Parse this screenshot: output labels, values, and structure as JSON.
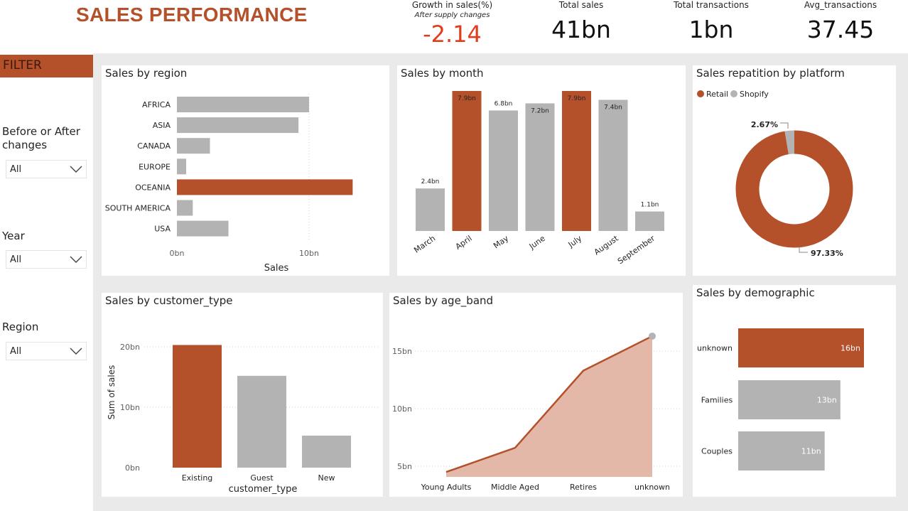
{
  "header": {
    "title": "SALES PERFORMANCE"
  },
  "kpis": {
    "growth": {
      "label": "Growth in sales(%)",
      "sublabel": "After supply changes",
      "value": "-2.14",
      "color": "#e03c1d"
    },
    "total_sales": {
      "label": "Total sales",
      "value": "41bn"
    },
    "total_transactions": {
      "label": "Total transactions",
      "value": "1bn"
    },
    "avg_transactions": {
      "label": "Avg_transactions",
      "value": "37.45"
    }
  },
  "filters": {
    "header": "FILTER",
    "items": [
      {
        "label": "Before or After changes",
        "value": "All"
      },
      {
        "label": "Year",
        "value": "All"
      },
      {
        "label": "Region",
        "value": "All"
      }
    ]
  },
  "colors": {
    "accent": "#b4502a",
    "neutral": "#b3b3b3",
    "area_fill": "#e3b8a8"
  },
  "chart_data": [
    {
      "id": "region",
      "type": "bar",
      "orientation": "horizontal",
      "title": "Sales by region",
      "xlabel": "Sales",
      "categories": [
        "AFRICA",
        "ASIA",
        "CANADA",
        "EUROPE",
        "OCEANIA",
        "SOUTH AMERICA",
        "USA"
      ],
      "values": [
        10.0,
        9.2,
        2.5,
        0.7,
        13.3,
        1.2,
        3.9
      ],
      "highlight": [
        false,
        false,
        false,
        false,
        true,
        false,
        false
      ],
      "ticks": [
        "0bn",
        "10bn"
      ],
      "xlim": [
        0,
        13.5
      ]
    },
    {
      "id": "month",
      "type": "bar",
      "title": "Sales by month",
      "categories": [
        "March",
        "April",
        "May",
        "June",
        "July",
        "August",
        "September"
      ],
      "values": [
        2.4,
        7.9,
        6.8,
        7.2,
        7.9,
        7.4,
        1.1
      ],
      "labels": [
        "2.4bn",
        "7.9bn",
        "6.8bn",
        "7.2bn",
        "7.9bn",
        "7.4bn",
        "1.1bn"
      ],
      "highlight": [
        false,
        true,
        false,
        false,
        true,
        false,
        false
      ],
      "ylim": [
        0,
        7.9
      ]
    },
    {
      "id": "platform",
      "type": "pie",
      "title": "Sales repatition by platform",
      "legend": [
        "Retail",
        "Shopify"
      ],
      "values": [
        97.33,
        2.67
      ],
      "labels": [
        "97.33%",
        "2.67%"
      ]
    },
    {
      "id": "customer",
      "type": "bar",
      "title": "Sales by customer_type",
      "xlabel": "customer_type",
      "ylabel": "Sum of sales",
      "categories": [
        "Existing",
        "Guest",
        "New"
      ],
      "values": [
        20.3,
        15.2,
        5.3
      ],
      "highlight": [
        true,
        false,
        false
      ],
      "ticks": [
        "0bn",
        "10bn",
        "20bn"
      ],
      "ylim": [
        0,
        20
      ]
    },
    {
      "id": "age",
      "type": "area",
      "title": "Sales by age_band",
      "categories": [
        "Young Adults",
        "Middle Aged",
        "Retires",
        "unknown"
      ],
      "values": [
        4.5,
        6.6,
        13.3,
        16.3
      ],
      "ticks": [
        "5bn",
        "10bn",
        "15bn"
      ],
      "ylim": [
        5,
        15
      ]
    },
    {
      "id": "demographic",
      "type": "bar",
      "orientation": "horizontal",
      "title": "Sales by demographic",
      "categories": [
        "unknown",
        "Families",
        "Couples"
      ],
      "values": [
        16,
        13,
        11
      ],
      "labels": [
        "16bn",
        "13bn",
        "11bn"
      ],
      "highlight": [
        true,
        false,
        false
      ]
    }
  ]
}
